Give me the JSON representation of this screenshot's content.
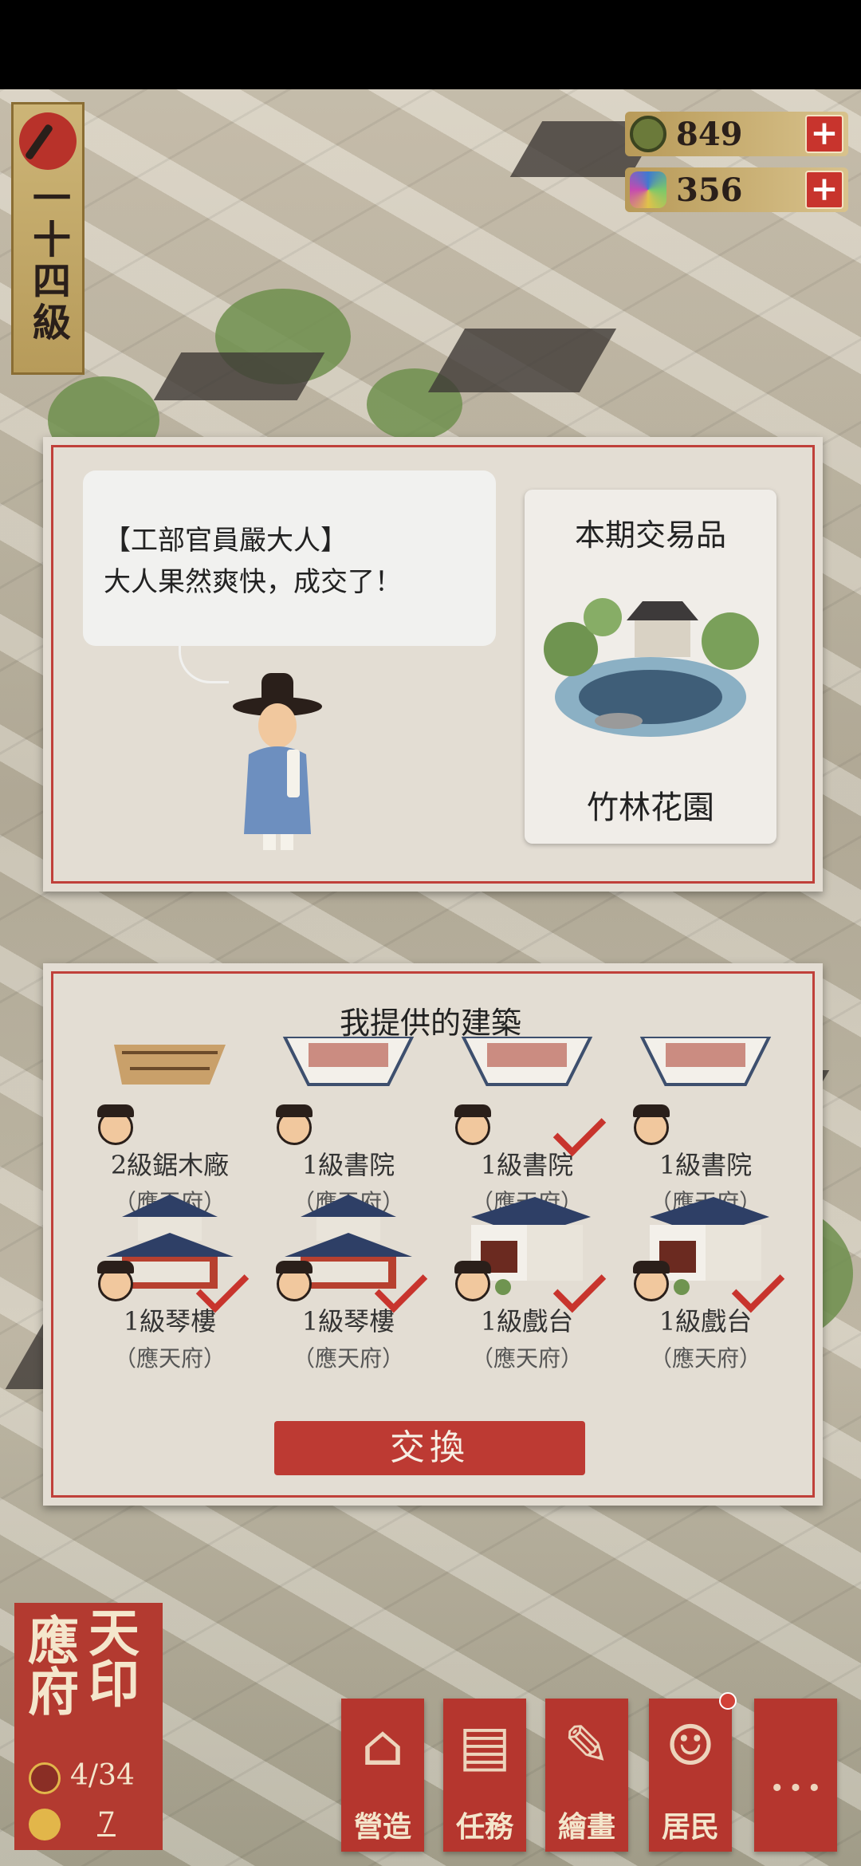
{
  "level": {
    "text": "一十四級"
  },
  "currencies": [
    {
      "icon": "copper-coin-icon",
      "value": "849",
      "plus": "+"
    },
    {
      "icon": "jade-gem-icon",
      "value": "356",
      "plus": "+"
    }
  ],
  "dialog": {
    "speaker": "【工部官員嚴大人】",
    "message": "大人果然爽快，成交了！"
  },
  "trade_item": {
    "title": "本期交易品",
    "name": "竹林花園"
  },
  "offer": {
    "title": "我提供的建築",
    "buildings": [
      {
        "name": "2級鋸木廠",
        "city": "（應天府）",
        "checked": false,
        "kind": "sawmill"
      },
      {
        "name": "1級書院",
        "city": "（應天府）",
        "checked": false,
        "kind": "academy"
      },
      {
        "name": "1級書院",
        "city": "（應天府）",
        "checked": true,
        "kind": "academy"
      },
      {
        "name": "1級書院",
        "city": "（應天府）",
        "checked": false,
        "kind": "academy"
      },
      {
        "name": "1級琴樓",
        "city": "（應天府）",
        "checked": true,
        "kind": "tower"
      },
      {
        "name": "1級琴樓",
        "city": "（應天府）",
        "checked": true,
        "kind": "tower"
      },
      {
        "name": "1級戲台",
        "city": "（應天府）",
        "checked": true,
        "kind": "stage"
      },
      {
        "name": "1級戲台",
        "city": "（應天府）",
        "checked": true,
        "kind": "stage"
      }
    ],
    "button": "交換"
  },
  "seal": {
    "col1": "應府",
    "col2": "天印",
    "population": "4/34",
    "second_stat": "7"
  },
  "nav": [
    {
      "label": "營造",
      "icon": "build-icon"
    },
    {
      "label": "任務",
      "icon": "task-icon"
    },
    {
      "label": "繪畫",
      "icon": "scroll-icon"
    },
    {
      "label": "居民",
      "icon": "resident-icon"
    },
    {
      "label": "…",
      "icon": "more-icon"
    }
  ]
}
